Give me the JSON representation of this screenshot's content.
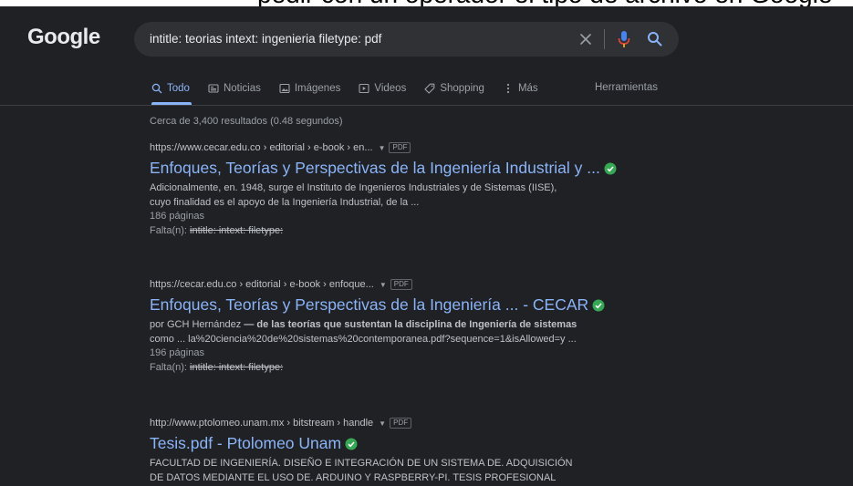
{
  "top_strip": {
    "text": "pedir con un operador el tipo de archivo en Google"
  },
  "logo": "Google",
  "search": {
    "query": "intitle: teorias intext: ingenieria filetype: pdf"
  },
  "tabs": [
    {
      "label": "Todo",
      "icon": "search-icon",
      "active": true
    },
    {
      "label": "Noticias",
      "icon": "news-icon",
      "active": false
    },
    {
      "label": "Imágenes",
      "icon": "image-icon",
      "active": false
    },
    {
      "label": "Videos",
      "icon": "video-icon",
      "active": false
    },
    {
      "label": "Shopping",
      "icon": "tag-icon",
      "active": false
    },
    {
      "label": "Más",
      "icon": "more-vert-icon",
      "active": false
    }
  ],
  "tools_label": "Herramientas",
  "stats": "Cerca de 3,400 resultados (0.48 segundos)",
  "results": [
    {
      "url": "https://www.cecar.edu.co › editorial › e-book › en...",
      "badge": "PDF",
      "title": "Enfoques, Teorías y Perspectivas de la Ingeniería Industrial y ...",
      "snippet_line1": "Adicionalmente, en. 1948, surge el Instituto de Ingenieros Industriales y de Sistemas (IISE),",
      "snippet_line2": "cuyo finalidad es el apoyo de la Ingeniería Industrial, de la ...",
      "pages": "186 páginas",
      "missing_label": "Falta(n):",
      "missing_terms": "intitle: intext: filetype:"
    },
    {
      "url": "https://cecar.edu.co › editorial › e-book › enfoque...",
      "badge": "PDF",
      "title": "Enfoques, Teorías y Perspectivas de la Ingeniería ... - CECAR",
      "snippet_author": "por GCH Hernández",
      "snippet_line1_rest": " — de las teorías que sustentan la disciplina de Ingeniería de sistemas",
      "snippet_line2": "como ... la%20ciencia%20de%20sistemas%20contemporanea.pdf?sequence=1&isAllowed=y ...",
      "pages": "196 páginas",
      "missing_label": "Falta(n):",
      "missing_terms": "intitle: intext: filetype:"
    },
    {
      "url": "http://www.ptolomeo.unam.mx › bitstream › handle",
      "badge": "PDF",
      "title": "Tesis.pdf - Ptolomeo Unam",
      "snippet_line1": "FACULTAD DE INGENIERÍA. DISEÑO E INTEGRACIÓN DE UN SISTEMA DE. ADQUISICIÓN",
      "snippet_line2": "DE DATOS MEDIANTE EL USO DE. ARDUINO Y RASPBERRY-PI. TESIS PROFESIONAL"
    }
  ],
  "colors": {
    "background": "#202124",
    "link": "#8ab4f8",
    "verified": "#34a853",
    "mic_blue": "#4285f4",
    "mic_red": "#ea4335"
  }
}
